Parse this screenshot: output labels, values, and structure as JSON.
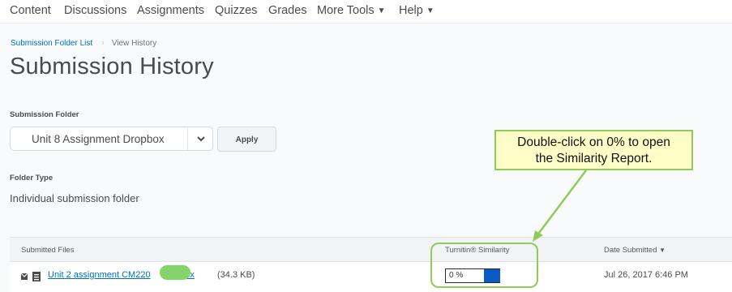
{
  "topnav": {
    "items": [
      {
        "label": "Content"
      },
      {
        "label": "Discussions"
      },
      {
        "label": "Assignments"
      },
      {
        "label": "Quizzes"
      },
      {
        "label": "Grades"
      },
      {
        "label": "More Tools",
        "has_dropdown": true
      },
      {
        "label": "Help",
        "has_dropdown": true
      }
    ]
  },
  "breadcrumb": {
    "link": "Submission Folder List",
    "current": "View History"
  },
  "page": {
    "title": "Submission History"
  },
  "form": {
    "folder_label": "Submission Folder",
    "folder_value": "Unit 8 Assignment Dropbox",
    "apply_label": "Apply",
    "type_label": "Folder Type",
    "type_value": "Individual submission folder"
  },
  "table": {
    "headers": {
      "files": "Submitted Files",
      "similarity": "Turnitin® Similarity",
      "date": "Date Submitted"
    },
    "rows": [
      {
        "file_name": "Unit 2 assignment CM220",
        "file_name_end": ".docx",
        "file_size": "(34.3 KB)",
        "similarity": "0 %",
        "similarity_fraction": 0,
        "date": "Jul 26, 2017 6:46 PM"
      }
    ]
  },
  "callout": {
    "line1": "Double-click on 0% to open",
    "line2": "the Similarity Report."
  },
  "colors": {
    "link": "#006fbf",
    "callout_border": "#8fcb57",
    "callout_fill": "#fffec9",
    "similarity_bar": "#0a5ac4"
  }
}
